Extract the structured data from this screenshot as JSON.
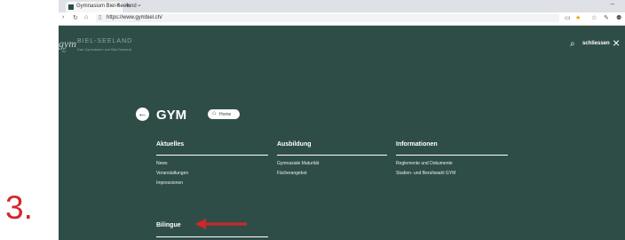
{
  "step_label": "3.",
  "browser": {
    "tab_title": "Gymnasium Biel-Seeland",
    "new_tab": "+",
    "tab_menu": "⌄",
    "url": "https://www.gymbiel.ch/",
    "window_minimize": "–"
  },
  "header": {
    "logo_mark": "gym",
    "logo_name": "BIEL-SEELAND",
    "logo_tagline": "Das Gymnasium von Biel-Seeland",
    "logo_small": "fur",
    "close_label": "schliessen",
    "close_icon": "×",
    "search_icon": "⌕"
  },
  "menu": {
    "back_icon": "←",
    "title": "GYM",
    "home_label": "Home",
    "home_icon": "⌂",
    "columns": [
      {
        "heading": "Aktuelles",
        "links": [
          "News",
          "Veranstaltungen",
          "Impressionen"
        ]
      },
      {
        "heading": "Ausbildung",
        "links": [
          "Gymnasiale Maturität",
          "Fächerangebot"
        ]
      },
      {
        "heading": "Informationen",
        "links": [
          "Reglemente und Dokumente",
          "Studien- und Berufswahl GYM"
        ]
      }
    ],
    "bilingue": "Bilingue"
  },
  "colors": {
    "background": "#2f4d47",
    "accent": "#d3262b"
  }
}
